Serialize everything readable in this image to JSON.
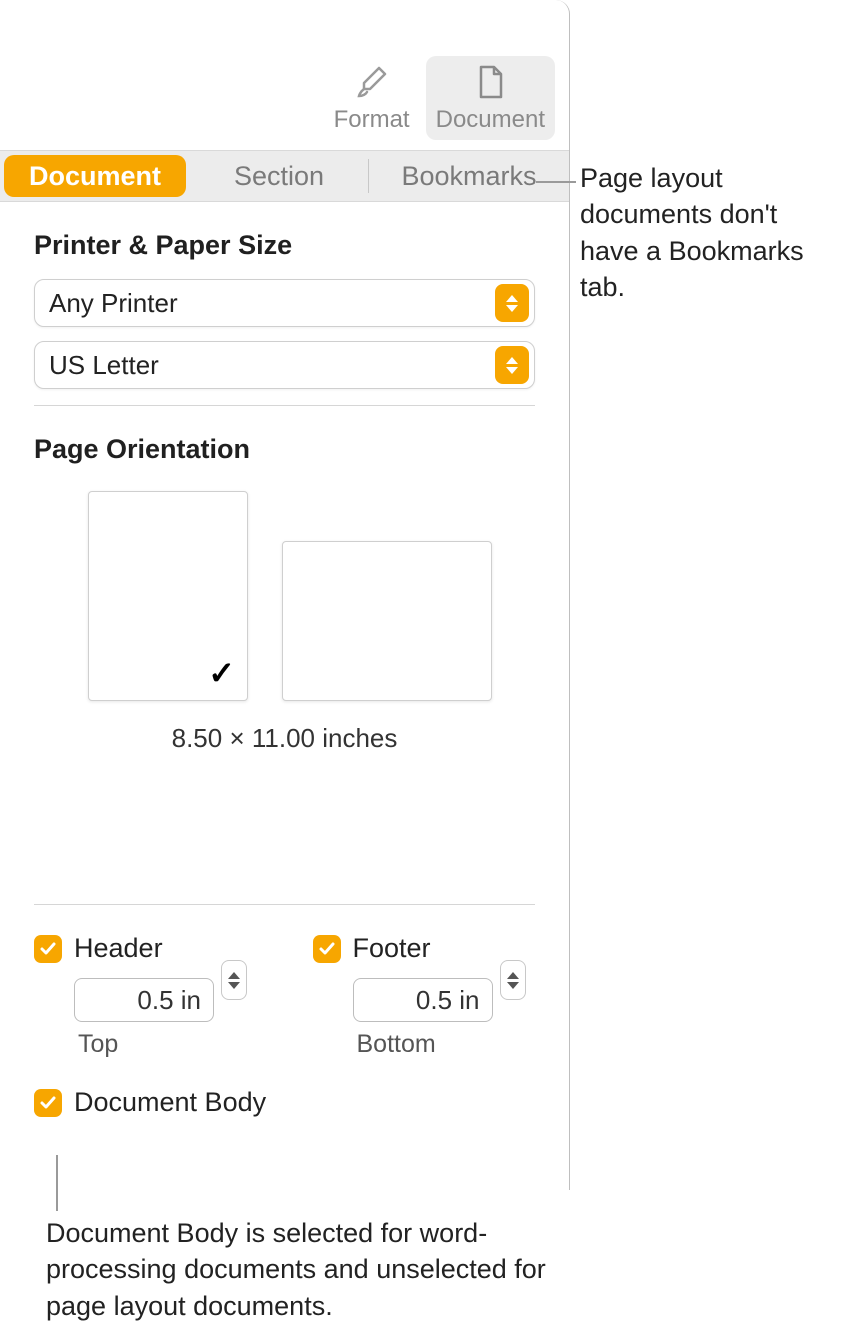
{
  "toolbar": {
    "format": "Format",
    "document": "Document"
  },
  "tabs": {
    "document": "Document",
    "section": "Section",
    "bookmarks": "Bookmarks"
  },
  "printer_section": {
    "title": "Printer & Paper Size",
    "printer": "Any Printer",
    "paper": "US Letter"
  },
  "orientation": {
    "title": "Page Orientation",
    "size_label": "8.50 × 11.00 inches"
  },
  "header": {
    "label": "Header",
    "value": "0.5 in",
    "sub": "Top"
  },
  "footer": {
    "label": "Footer",
    "value": "0.5 in",
    "sub": "Bottom"
  },
  "docbody": {
    "label": "Document Body"
  },
  "annotations": {
    "bookmarks_note": "Page layout documents don't have a Bookmarks tab.",
    "docbody_note": "Document Body is selected for word-processing documents and unselected for page layout documents."
  }
}
